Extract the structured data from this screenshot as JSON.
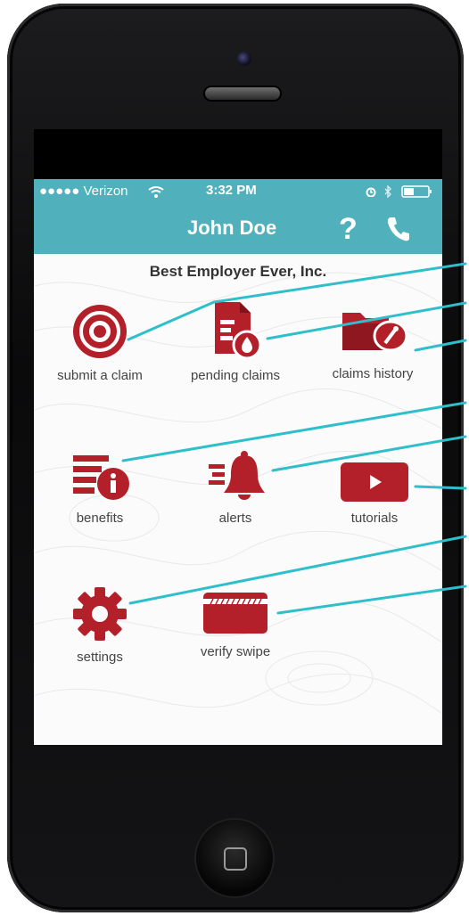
{
  "status_bar": {
    "carrier": "●●●●● Verizon",
    "time": "3:32 PM"
  },
  "header": {
    "title": "John Doe",
    "help_label": "?"
  },
  "employer": "Best Employer Ever, Inc.",
  "tiles": [
    {
      "label": "submit a claim",
      "icon": "target-icon"
    },
    {
      "label": "pending claims",
      "icon": "pending-document-icon"
    },
    {
      "label": "claims history",
      "icon": "folder-history-icon"
    },
    {
      "label": "benefits",
      "icon": "info-list-icon"
    },
    {
      "label": "alerts",
      "icon": "bell-icon"
    },
    {
      "label": "tutorials",
      "icon": "play-icon"
    },
    {
      "label": "settings",
      "icon": "gear-icon"
    },
    {
      "label": "verify swipe",
      "icon": "card-icon"
    }
  ],
  "colors": {
    "accent": "#50b0bb",
    "icon_red": "#b3202a",
    "callout": "#2fbfcb"
  }
}
